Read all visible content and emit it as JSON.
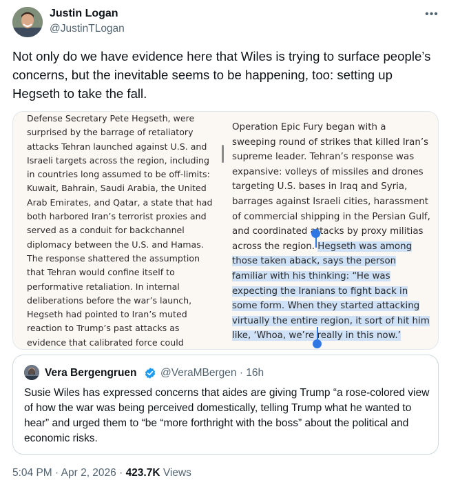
{
  "author": {
    "name": "Justin Logan",
    "handle": "@JustinTLogan"
  },
  "more_label": "•••",
  "tweet_text": "Not only do we have evidence here that Wiles is trying to surface people’s concerns, but the inevitable seems to be happening, too: setting up Hegseth to take the fall.",
  "media": {
    "left_column": "Defense Secretary Pete Hegseth, were surprised by the barrage of retaliatory attacks Tehran launched against U.S. and Israeli targets across the region, including in countries long assumed to be off-limits: Kuwait, Bahrain, Saudi Arabia, the United Arab Emirates, and Qatar, a state that had both harbored Iran’s terrorist proxies and served as a conduit for backchannel diplomacy between the U.S. and Hamas. The response shattered the assumption that Tehran would confine itself to performative retaliation. In internal deliberations before the war’s launch, Hegseth had pointed to Iran’s muted reaction to Trump’s past attacks as evidence that calibrated force could",
    "right_column_before": "Operation Epic Fury began with a sweeping round of strikes that killed Iran’s supreme leader. Tehran’s response was expansive: volleys of missiles and drones targeting U.S. bases in Iraq and Syria, barrages against Israeli cities, harassment of commercial shipping in the Persian Gulf, and coordinated attacks by proxy militias across the region. ",
    "right_column_highlight": "Hegseth was among those taken aback, says the person familiar with his thinking: “He was expecting the Iranians to fight back in some form. When they started attacking virtually the entire region, it sort of hit him like, ‘Whoa, we’re really in this now.’"
  },
  "quote": {
    "name": "Vera Bergengruen",
    "handle_time": "@VeraMBergen · 16h",
    "text": "Susie Wiles has expressed concerns that aides are giving Trump “a rose-colored view of how the war was being perceived domestically, telling Trump what he wanted to hear” and urged them to “be “more forthright with the boss” about the political and economic risks."
  },
  "meta": {
    "timestamp": "5:04 PM · Apr 2, 2026 · ",
    "views_count": "423.7K",
    "views_label": " Views"
  },
  "colors": {
    "highlight": "#cfe1f6",
    "selection_handle": "#2f78e4",
    "verified_badge": "#1d9bf0",
    "secondary_text": "#536471"
  }
}
